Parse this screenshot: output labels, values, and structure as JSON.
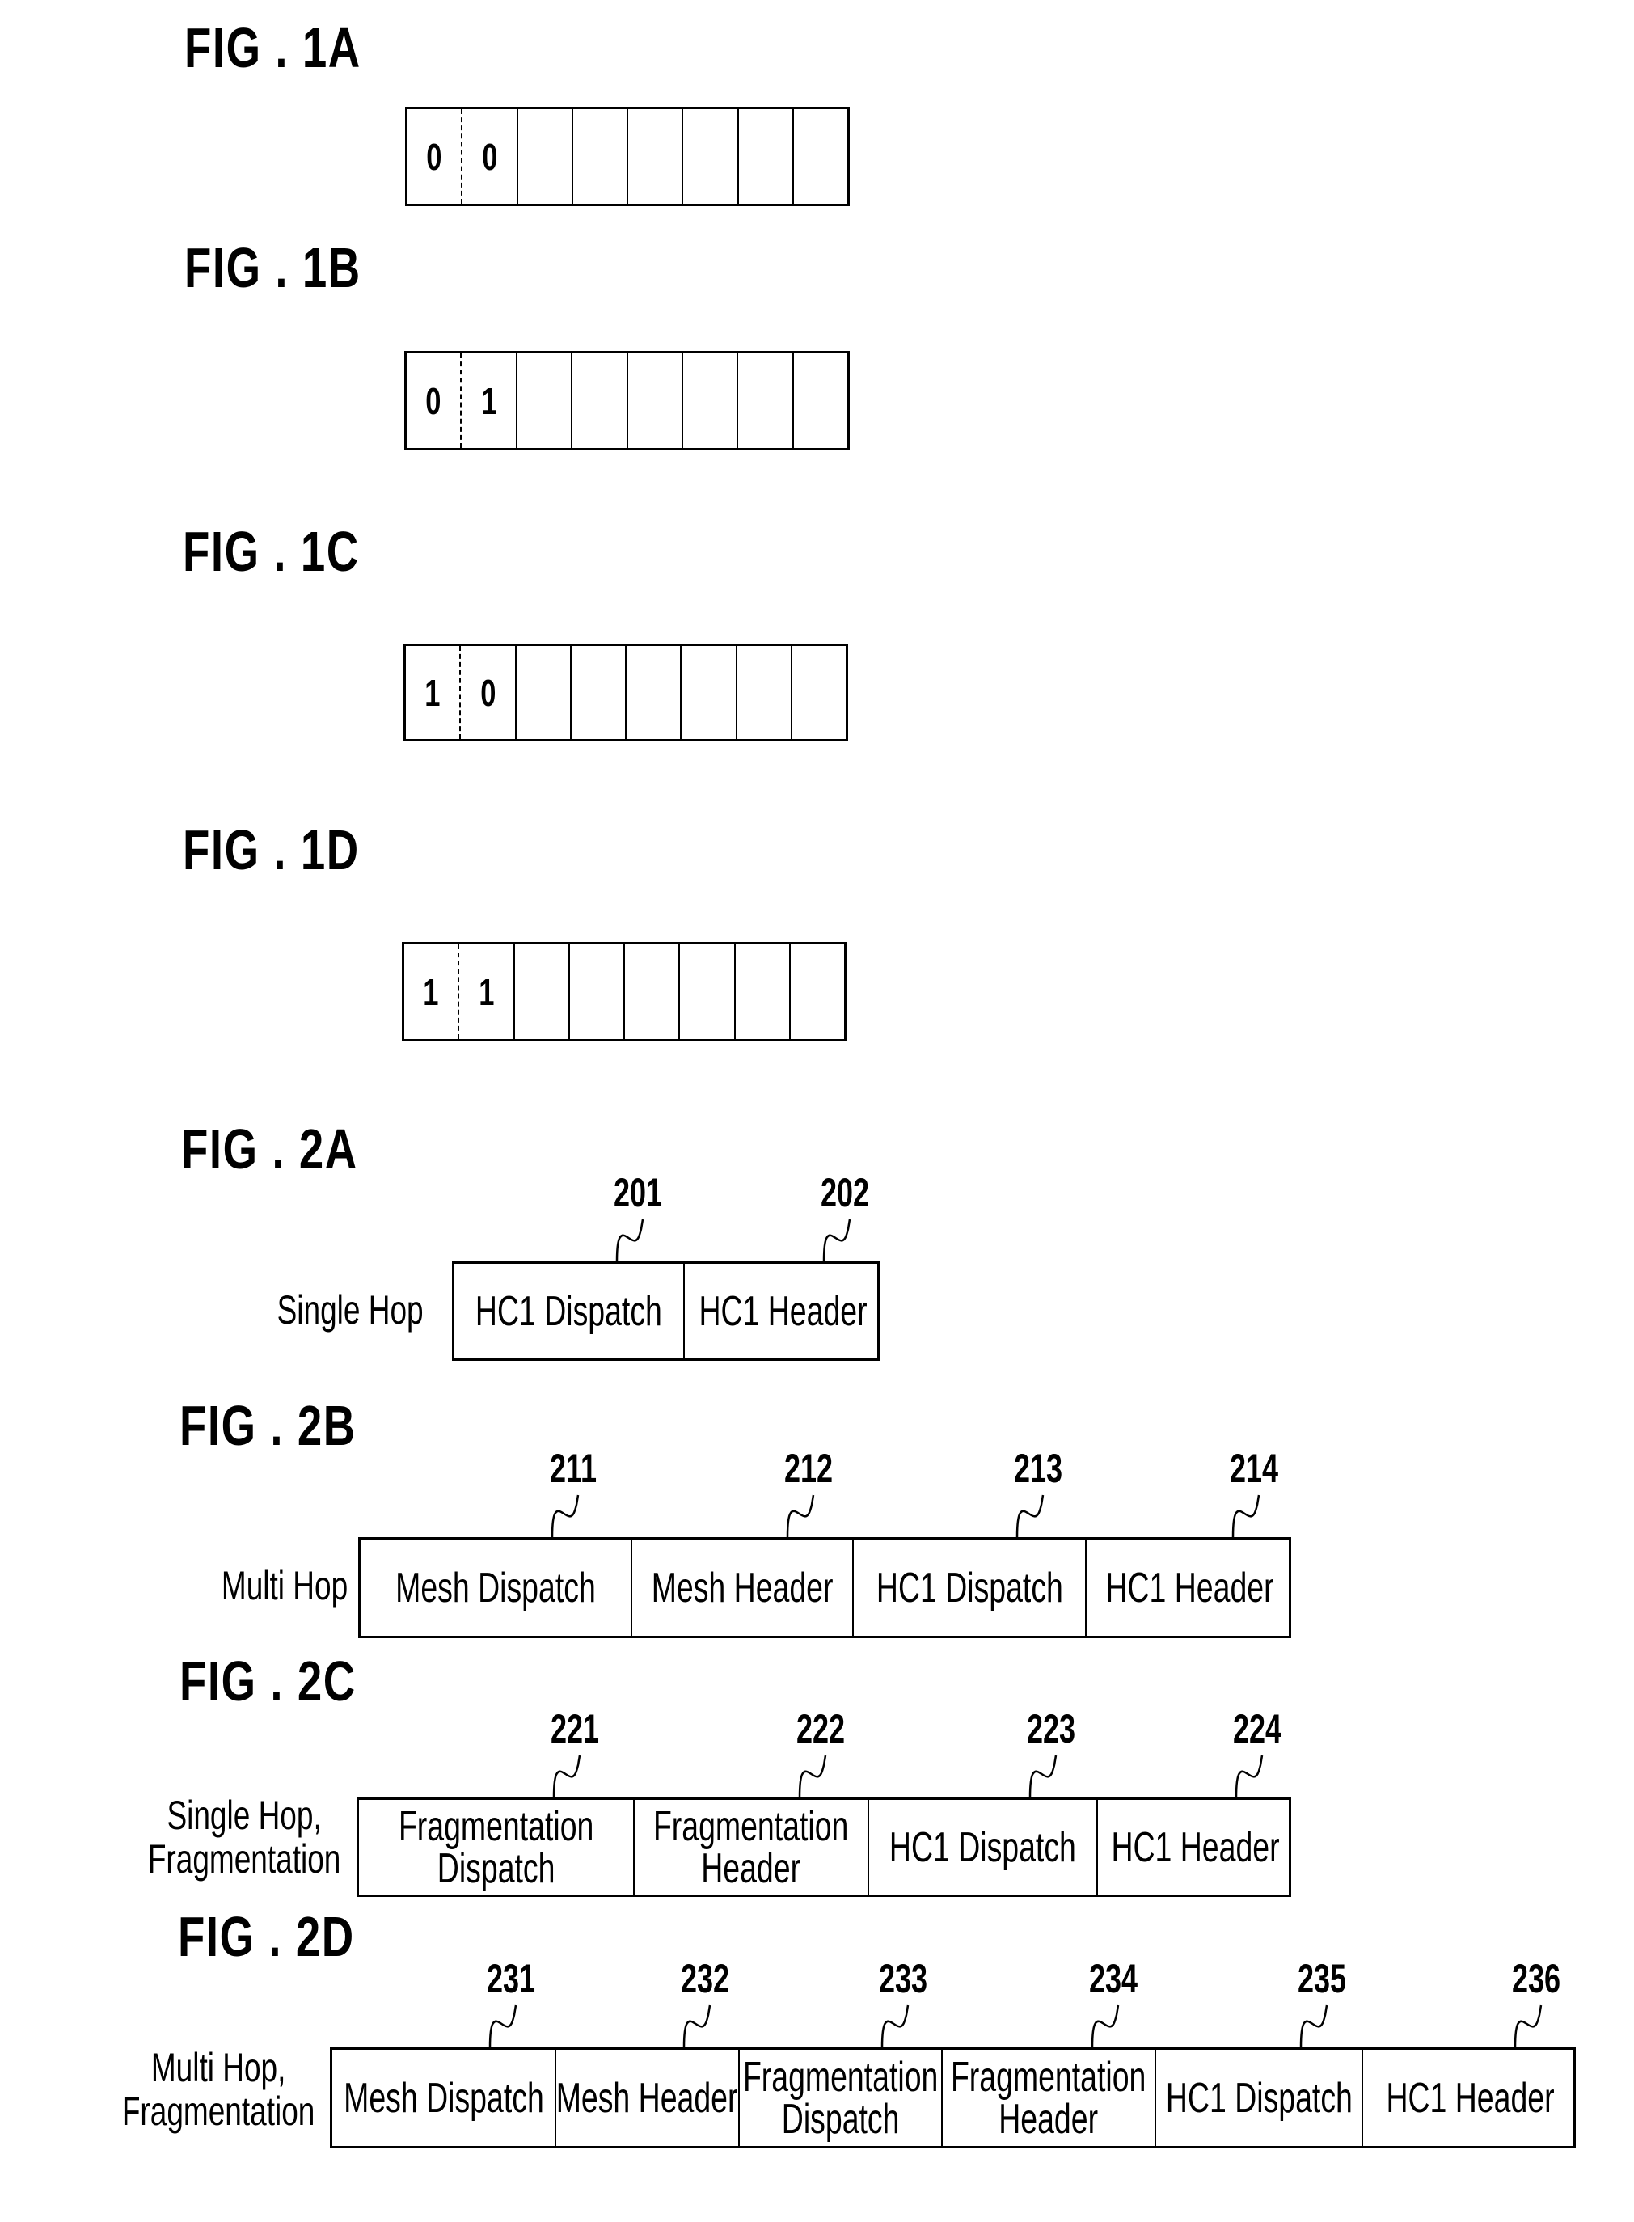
{
  "figures": {
    "fig1a": {
      "title": "FIG . 1A",
      "bits": [
        "0",
        "0",
        "",
        "",
        "",
        "",
        "",
        ""
      ]
    },
    "fig1b": {
      "title": "FIG . 1B",
      "bits": [
        "0",
        "1",
        "",
        "",
        "",
        "",
        "",
        ""
      ]
    },
    "fig1c": {
      "title": "FIG . 1C",
      "bits": [
        "1",
        "0",
        "",
        "",
        "",
        "",
        "",
        ""
      ]
    },
    "fig1d": {
      "title": "FIG . 1D",
      "bits": [
        "1",
        "1",
        "",
        "",
        "",
        "",
        "",
        ""
      ]
    },
    "fig2a": {
      "title": "FIG . 2A",
      "row_label": [
        "Single Hop"
      ],
      "fields": [
        {
          "ref": "201",
          "label": [
            "HC1 Dispatch"
          ]
        },
        {
          "ref": "202",
          "label": [
            "HC1 Header"
          ]
        }
      ]
    },
    "fig2b": {
      "title": "FIG . 2B",
      "row_label": [
        "Multi Hop"
      ],
      "fields": [
        {
          "ref": "211",
          "label": [
            "Mesh Dispatch"
          ]
        },
        {
          "ref": "212",
          "label": [
            "Mesh Header"
          ]
        },
        {
          "ref": "213",
          "label": [
            "HC1 Dispatch"
          ]
        },
        {
          "ref": "214",
          "label": [
            "HC1 Header"
          ]
        }
      ]
    },
    "fig2c": {
      "title": "FIG . 2C",
      "row_label": [
        "Single Hop,",
        "Fragmentation"
      ],
      "fields": [
        {
          "ref": "221",
          "label": [
            "Fragmentation",
            "Dispatch"
          ]
        },
        {
          "ref": "222",
          "label": [
            "Fragmentation",
            "Header"
          ]
        },
        {
          "ref": "223",
          "label": [
            "HC1 Dispatch"
          ]
        },
        {
          "ref": "224",
          "label": [
            "HC1 Header"
          ]
        }
      ]
    },
    "fig2d": {
      "title": "FIG . 2D",
      "row_label": [
        "Multi Hop,",
        "Fragmentation"
      ],
      "fields": [
        {
          "ref": "231",
          "label": [
            "Mesh Dispatch"
          ]
        },
        {
          "ref": "232",
          "label": [
            "Mesh Header"
          ]
        },
        {
          "ref": "233",
          "label": [
            "Fragmentation",
            "Dispatch"
          ]
        },
        {
          "ref": "234",
          "label": [
            "Fragmentation",
            "Header"
          ]
        },
        {
          "ref": "235",
          "label": [
            "HC1 Dispatch"
          ]
        },
        {
          "ref": "236",
          "label": [
            "HC1 Header"
          ]
        }
      ]
    }
  }
}
